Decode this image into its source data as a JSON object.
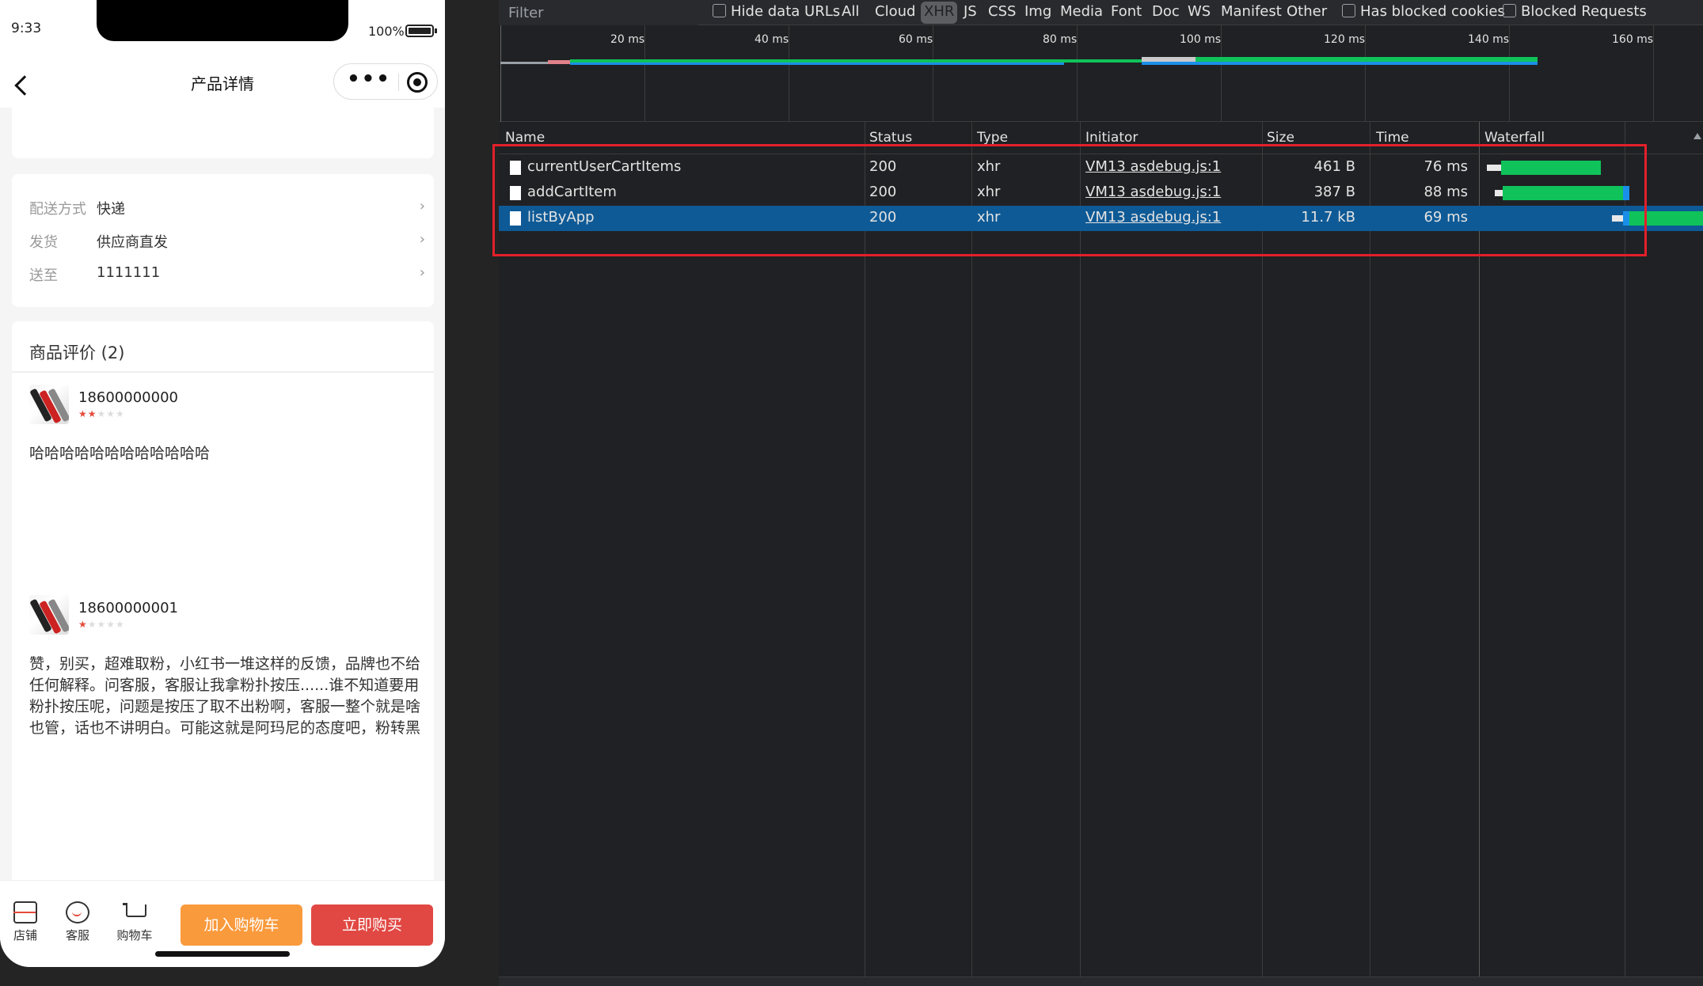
{
  "phone": {
    "status": {
      "time": "9:33",
      "battery": "100%"
    },
    "nav": {
      "title": "产品详情"
    },
    "delivery": [
      {
        "label": "配送方式",
        "value": "快递"
      },
      {
        "label": "发货",
        "value": "供应商直发"
      },
      {
        "label": "送至",
        "value": "1111111"
      }
    ],
    "reviews": {
      "header": "商品评价 (2)",
      "items": [
        {
          "user": "18600000000",
          "rating": 2,
          "text": "哈哈哈哈哈哈哈哈哈哈哈哈"
        },
        {
          "user": "18600000001",
          "rating": 1,
          "text": "赞，别买，超难取粉，小红书一堆这样的反馈，品牌也不给任何解释。问客服，客服让我拿粉扑按压......谁不知道要用粉扑按压呢，问题是按压了取不出粉啊，客服一整个就是啥也管，话也不讲明白。可能这就是阿玛尼的态度吧，粉转黑"
        }
      ]
    },
    "bottom": {
      "shop": "店铺",
      "service": "客服",
      "cart": "购物车",
      "add_to_cart": "加入购物车",
      "buy_now": "立即购买"
    }
  },
  "devtools": {
    "filter_placeholder": "Filter",
    "toolbar": {
      "hide_data_urls": "Hide data URLs",
      "types": [
        "All",
        "Cloud",
        "XHR",
        "JS",
        "CSS",
        "Img",
        "Media",
        "Font",
        "Doc",
        "WS",
        "Manifest",
        "Other"
      ],
      "active_type": "XHR",
      "has_blocked_cookies": "Has blocked cookies",
      "blocked_requests": "Blocked Requests"
    },
    "overview_ticks": [
      "20 ms",
      "40 ms",
      "60 ms",
      "80 ms",
      "100 ms",
      "120 ms",
      "140 ms",
      "160 ms"
    ],
    "columns": [
      "Name",
      "Status",
      "Type",
      "Initiator",
      "Size",
      "Time",
      "Waterfall"
    ],
    "rows": [
      {
        "name": "currentUserCartItems",
        "status": "200",
        "type": "xhr",
        "initiator": "VM13 asdebug.js:1",
        "size": "461 B",
        "time": "76 ms",
        "selected": false
      },
      {
        "name": "addCartItem",
        "status": "200",
        "type": "xhr",
        "initiator": "VM13 asdebug.js:1",
        "size": "387 B",
        "time": "88 ms",
        "selected": false
      },
      {
        "name": "listByApp",
        "status": "200",
        "type": "xhr",
        "initiator": "VM13 asdebug.js:1",
        "size": "11.7 kB",
        "time": "69 ms",
        "selected": true
      }
    ],
    "colors": {
      "selected_row": "#0e5a96",
      "waterfall_green": "#0fc35a",
      "waterfall_blue": "#1a8fe8",
      "highlight_box": "#e3202a"
    }
  }
}
